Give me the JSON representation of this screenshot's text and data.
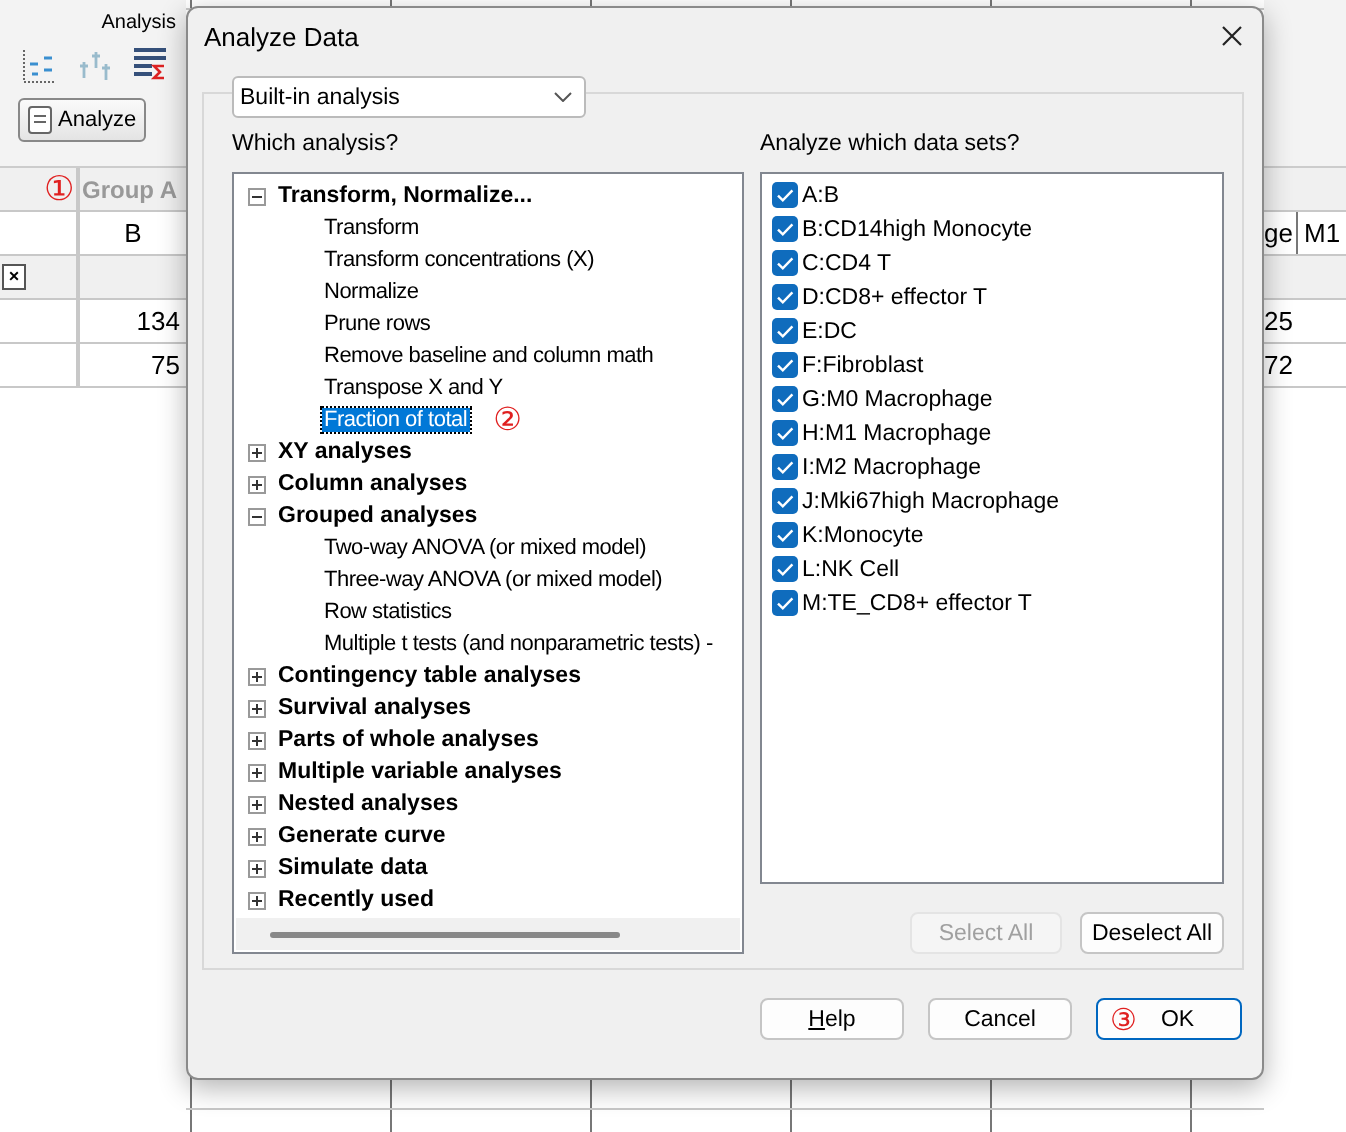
{
  "ribbon": {
    "group_label": "Analysis",
    "analyze_button": "Analyze"
  },
  "sheet": {
    "step_mark": "①",
    "group_header": "Group A",
    "column_title": "B",
    "clear_mark": "×",
    "left_values": [
      "134",
      "75"
    ],
    "right_titles": [
      "ge",
      "M1"
    ],
    "right_values": [
      "25",
      "72"
    ]
  },
  "dialog": {
    "title": "Analyze Data",
    "source": {
      "value": "Built-in analysis"
    },
    "analysis_label": "Which analysis?",
    "tree": [
      {
        "label": "Transform, Normalize...",
        "expanded": true,
        "children": [
          {
            "label": "Transform",
            "selected": false
          },
          {
            "label": "Transform concentrations (X)",
            "selected": false
          },
          {
            "label": "Normalize",
            "selected": false
          },
          {
            "label": "Prune rows",
            "selected": false
          },
          {
            "label": "Remove baseline and column math",
            "selected": false
          },
          {
            "label": "Transpose X and Y",
            "selected": false
          },
          {
            "label": "Fraction of total",
            "selected": true,
            "step_mark": "②"
          }
        ]
      },
      {
        "label": "XY analyses",
        "expanded": false
      },
      {
        "label": "Column analyses",
        "expanded": false
      },
      {
        "label": "Grouped analyses",
        "expanded": true,
        "children": [
          {
            "label": "Two-way ANOVA (or mixed model)",
            "selected": false
          },
          {
            "label": "Three-way ANOVA (or mixed model)",
            "selected": false
          },
          {
            "label": "Row statistics",
            "selected": false
          },
          {
            "label": "Multiple t tests (and nonparametric tests) -",
            "selected": false
          }
        ]
      },
      {
        "label": "Contingency table analyses",
        "expanded": false
      },
      {
        "label": "Survival analyses",
        "expanded": false
      },
      {
        "label": "Parts of whole analyses",
        "expanded": false
      },
      {
        "label": "Multiple variable analyses",
        "expanded": false
      },
      {
        "label": "Nested analyses",
        "expanded": false
      },
      {
        "label": "Generate curve",
        "expanded": false
      },
      {
        "label": "Simulate data",
        "expanded": false
      },
      {
        "label": "Recently used",
        "expanded": false
      }
    ],
    "datasets_label": "Analyze which data sets?",
    "datasets": [
      {
        "label": "A:B",
        "checked": true
      },
      {
        "label": "B:CD14high Monocyte",
        "checked": true
      },
      {
        "label": "C:CD4 T",
        "checked": true
      },
      {
        "label": "D:CD8+ effector T",
        "checked": true
      },
      {
        "label": "E:DC",
        "checked": true
      },
      {
        "label": "F:Fibroblast",
        "checked": true
      },
      {
        "label": "G:M0 Macrophage",
        "checked": true
      },
      {
        "label": "H:M1 Macrophage",
        "checked": true
      },
      {
        "label": "I:M2 Macrophage",
        "checked": true
      },
      {
        "label": "J:Mki67high Macrophage",
        "checked": true
      },
      {
        "label": "K:Monocyte",
        "checked": true
      },
      {
        "label": "L:NK Cell",
        "checked": true
      },
      {
        "label": "M:TE_CD8+ effector T",
        "checked": true
      }
    ],
    "list_buttons": [
      {
        "label": "Select All",
        "disabled": true
      },
      {
        "label": "Deselect All",
        "disabled": false
      }
    ],
    "footer_buttons": [
      {
        "label": "Help",
        "default": false
      },
      {
        "label": "Cancel",
        "default": false
      },
      {
        "label": "OK",
        "default": true,
        "step_mark": "③"
      }
    ]
  }
}
